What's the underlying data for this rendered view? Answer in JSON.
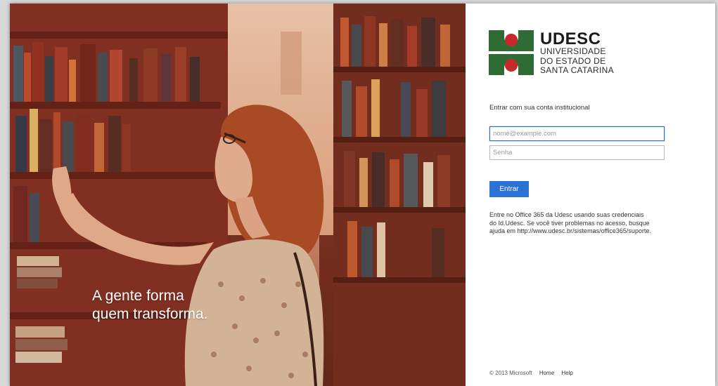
{
  "hero": {
    "tagline_line1": "A gente forma",
    "tagline_line2": "quem transforma."
  },
  "logo": {
    "brand": "UDESC",
    "line1": "UNIVERSIDADE",
    "line2": "DO ESTADO DE",
    "line3": "SANTA CATARINA",
    "colors": {
      "green": "#2f6b35",
      "red": "#c6282c"
    }
  },
  "login": {
    "prompt": "Entrar com sua conta institucional",
    "email_placeholder": "nome@example.com",
    "password_placeholder": "Senha",
    "submit_label": "Entrar",
    "accent": "#2a72d4"
  },
  "info": {
    "line1": "Entre no Office 365 da Udesc usando suas credenciais",
    "line2": "do Id.Udesc.  Se você tiver problemas no acesso, busque",
    "line3": "ajuda em http://www.udesc.br/sistemas/office365/suporte."
  },
  "footer": {
    "copyright": "© 2013 Microsoft",
    "home_label": "Home",
    "help_label": "Help"
  }
}
